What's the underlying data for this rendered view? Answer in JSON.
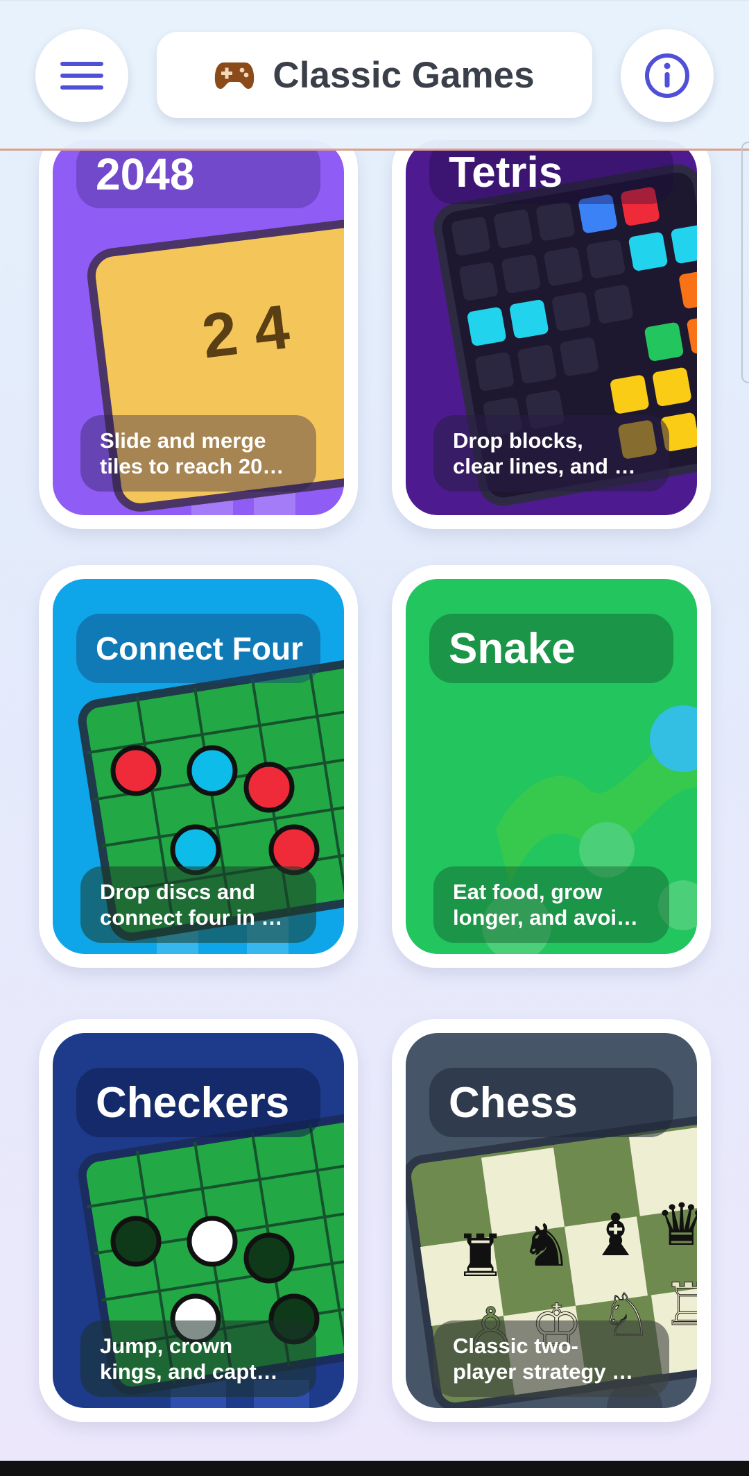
{
  "header": {
    "title": "Classic Games",
    "menu_icon": "menu-icon",
    "info_icon": "info-icon",
    "title_icon": "gamepad-icon",
    "accent": "#4f4fd8",
    "title_icon_color": "#8b4a1a"
  },
  "cards": [
    {
      "name": "2048",
      "description": "Slide and merge\ntiles to reach 20…",
      "color": "#8f5cf5",
      "tile_text": "2 4"
    },
    {
      "name": "Tetris",
      "description": "Drop blocks,\nclear lines, and …",
      "color": "#4d1b8f"
    },
    {
      "name": "Connect Four",
      "description": "Drop discs and\nconnect four in …",
      "color": "#0ea5e9"
    },
    {
      "name": "Snake",
      "description": "Eat food, grow\nlonger, and avoi…",
      "color": "#22c55e"
    },
    {
      "name": "Checkers",
      "description": "Jump, crown\nkings, and capt…",
      "color": "#1e3a8a"
    },
    {
      "name": "Chess",
      "description": "Classic two-\nplayer strategy …",
      "color": "#475569"
    }
  ]
}
